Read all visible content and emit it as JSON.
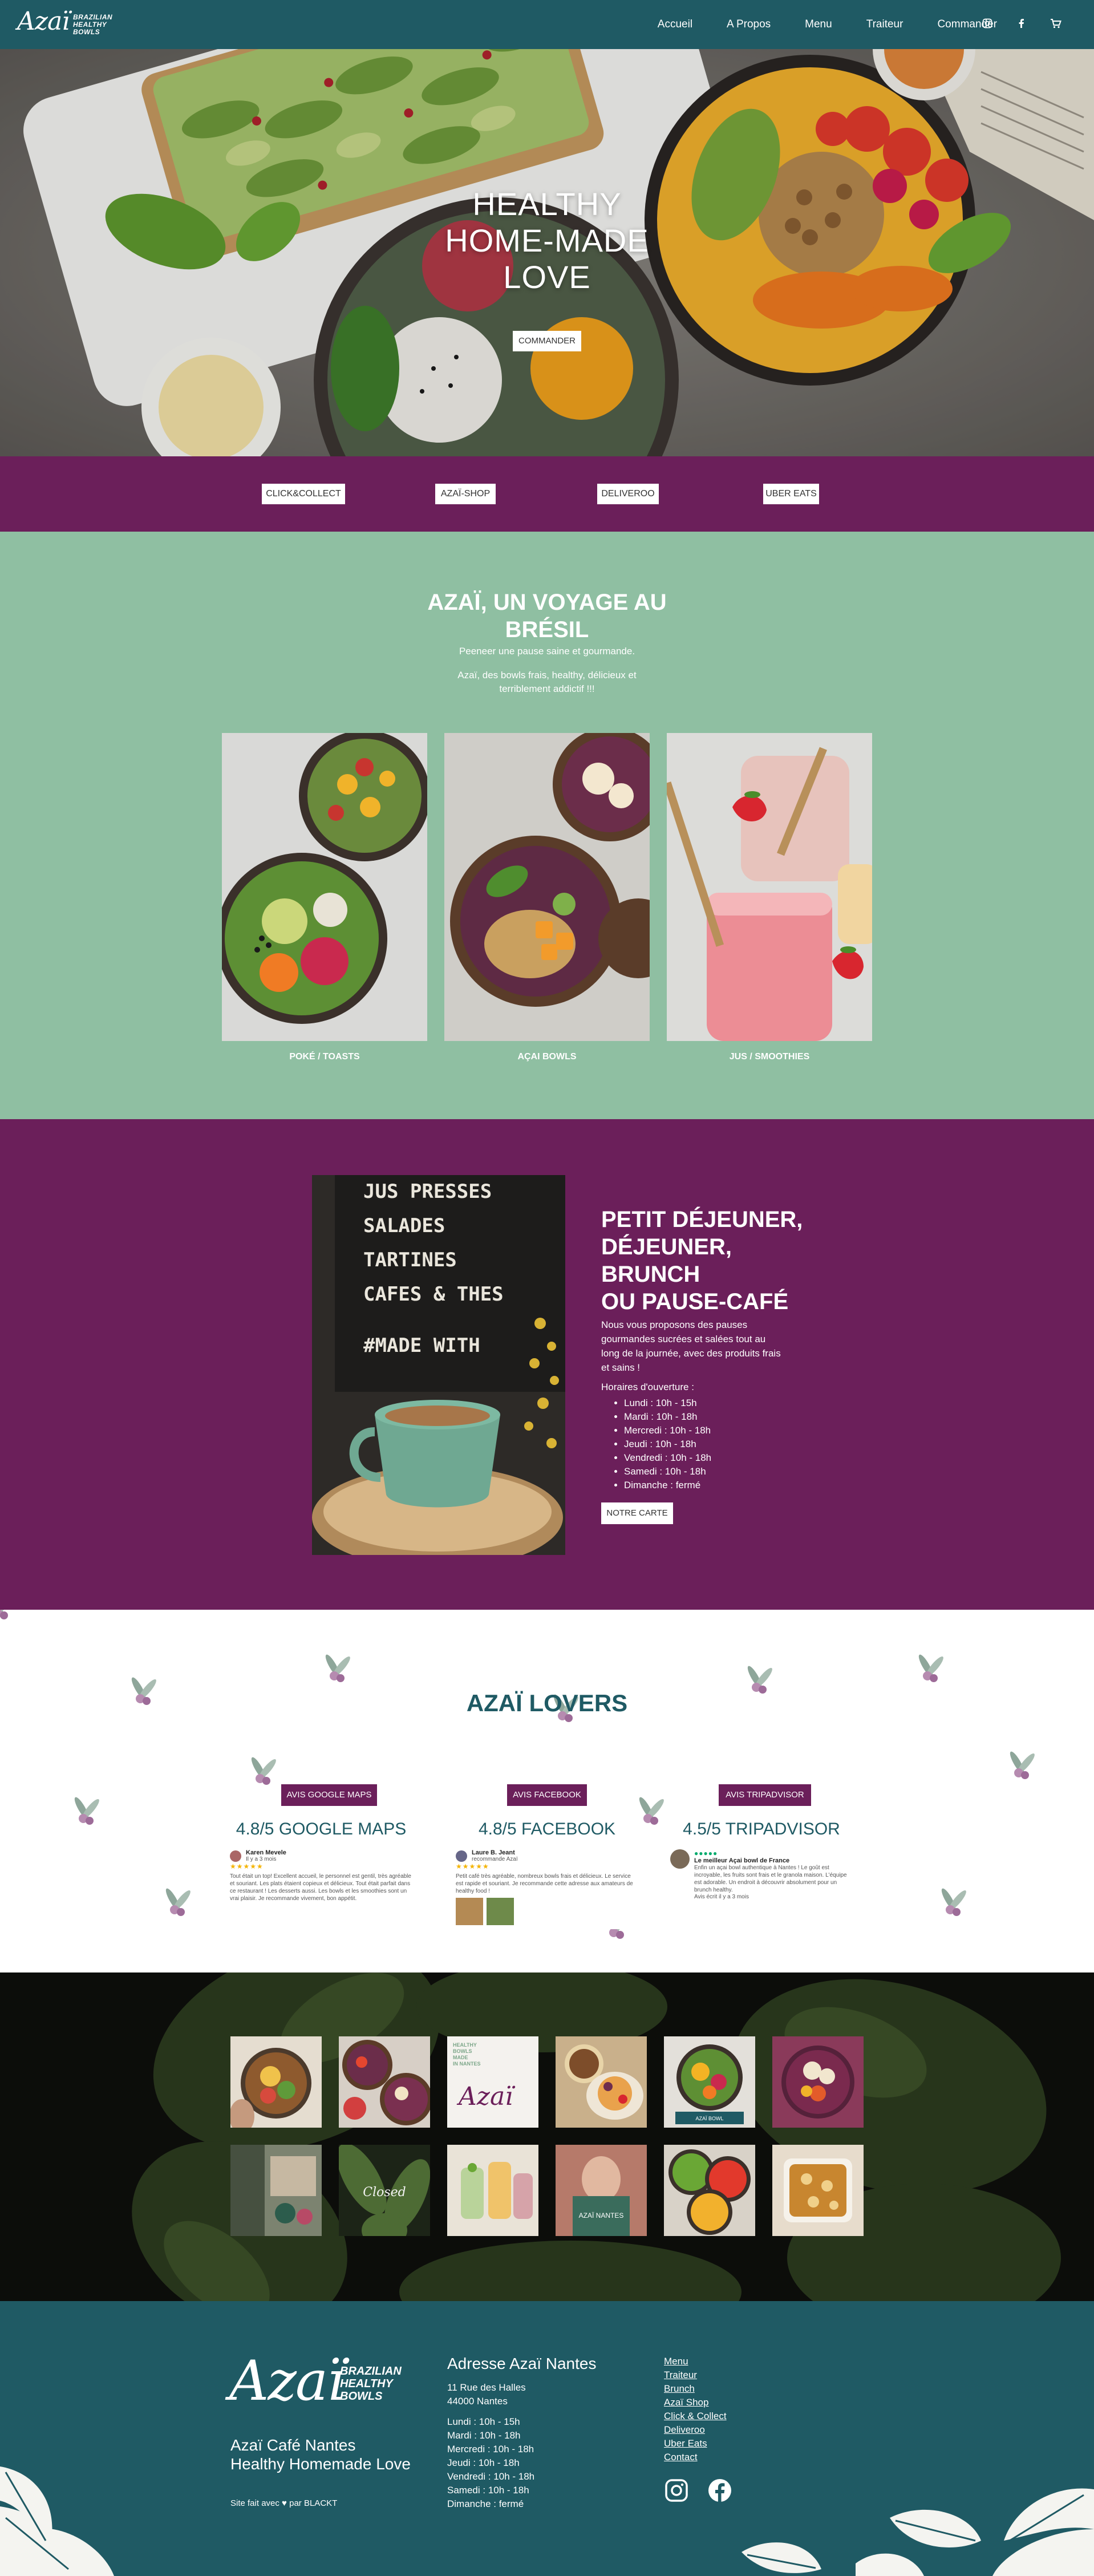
{
  "nav": {
    "logo_script": "Azaï",
    "logo_tag": [
      "BRAZILIAN",
      "HEALTHY",
      "BOWLS"
    ],
    "links": [
      "Accueil",
      "A Propos",
      "Menu",
      "Traiteur",
      "Commander"
    ],
    "icons": [
      "instagram-icon",
      "facebook-icon",
      "cart-icon"
    ]
  },
  "hero": {
    "title_lines": [
      "HEALTHY",
      "HOME-MADE",
      "LOVE"
    ],
    "button": "COMMANDER"
  },
  "order_bar": {
    "buttons": [
      "CLICK&COLLECT",
      "AZAÏ-SHOP",
      "DELIVEROO",
      "UBER EATS"
    ]
  },
  "voyage": {
    "title_lines": [
      "AZAÏ, UN VOYAGE AU",
      "BRÉSIL"
    ],
    "sub1": "Peeneer une pause saine et gourmande.",
    "sub2": "Azaï, des bowls frais, healthy, délicieux et",
    "sub3": "terriblement addictif !!!",
    "cards": [
      "POKÉ / TOASTS",
      "AÇAI BOWLS",
      "JUS / SMOOTHIES"
    ]
  },
  "breakfast": {
    "title_lines": [
      "PETIT DÉJEUNER,",
      "DÉJEUNER,",
      "BRUNCH",
      "OU PAUSE-CAFÉ"
    ],
    "intro": "Nous vous proposons des pauses gourmandes sucrées et salées tout au long de la journée, avec des produits frais et sains !",
    "hours_title": "Horaires d'ouverture :",
    "hours": [
      "Lundi : 10h - 15h",
      "Mardi : 10h - 18h",
      "Mercredi : 10h - 18h",
      "Jeudi : 10h - 18h",
      "Vendredi : 10h - 18h",
      "Samedi : 10h - 18h",
      "Dimanche : fermé"
    ],
    "button": "NOTRE CARTE",
    "board_lines": [
      "JUS PRESSES",
      "SALADES",
      "TARTINES",
      "CAFES & THES",
      "#MADE WITH"
    ]
  },
  "lovers": {
    "title": "AZAÏ LOVERS",
    "reviews": [
      {
        "badge": "AVIS GOOGLE MAPS",
        "score": "4.8/5 GOOGLE MAPS",
        "name": "Karen Mevele",
        "meta": "Il y a 3 mois",
        "text": "Tout était un top! Excellent accueil, le personnel est gentil, très agréable et souriant. Les plats étaient copieux et délicieux. Tout était parfait dans ce restaurant ! Les desserts aussi. Les bowls et les smoothies sont un vrai plaisir. Je recommande vivement, bon appétit."
      },
      {
        "badge": "AVIS FACEBOOK",
        "score": "4.8/5 FACEBOOK",
        "name": "Laure B. Jeant",
        "meta": "recommande Azaï",
        "text": "Petit café très agréable, nombreux bowls frais et délicieux. Le service est rapide et souriant. Je recommande cette adresse aux amateurs de healthy food !"
      },
      {
        "badge": "AVIS TRIPADVISOR",
        "score": "4.5/5 TRIPADVISOR",
        "name": "Le meilleur Açai bowl de France",
        "meta": "Avis écrit il y a 3 mois",
        "text": "Enfin un açai bowl authentique à Nantes ! Le goût est incroyable, les fruits sont frais et le granola maison. L'équipe est adorable. Un endroit à découvrir absolument pour un brunch healthy."
      }
    ]
  },
  "insta": {
    "tiles": [
      "insta-1",
      "insta-2",
      "insta-3",
      "insta-4",
      "insta-5",
      "insta-6",
      "insta-7",
      "insta-8",
      "insta-9",
      "insta-10",
      "insta-11",
      "insta-12"
    ],
    "tile3_text": [
      "HEALTHY",
      "BOWLS",
      "MADE",
      "IN NANTES"
    ],
    "tile3_logo": "Azaï",
    "tile8_text": "Closed",
    "tile10_text": "AZAÏ NANTES",
    "tile11_text": "AZAÏ BOWL"
  },
  "footer": {
    "logo_script": "Azaï",
    "logo_tag": [
      "BRAZILIAN",
      "HEALTHY",
      "BOWLS"
    ],
    "tagline": "Azaï Café Nantes Healthy Homemade Love",
    "credit": "Site fait avec ♥ par BLACKT",
    "addr_title": "Adresse Azaï Nantes",
    "addr": [
      "11 Rue des Halles",
      "44000 Nantes"
    ],
    "hours": [
      "Lundi : 10h - 15h",
      "Mardi : 10h - 18h",
      "Mercredi : 10h - 18h",
      "Jeudi : 10h - 18h",
      "Vendredi : 10h - 18h",
      "Samedi : 10h - 18h",
      "Dimanche : fermé"
    ],
    "menu": [
      "Menu",
      "Traiteur",
      "Brunch",
      "Azaï Shop",
      "Click & Collect",
      "Deliveroo",
      "Uber Eats",
      "Contact"
    ],
    "social": [
      "instagram-icon",
      "facebook-icon"
    ]
  },
  "colors": {
    "teal": "#1f5a64",
    "plum": "#6b1f5a",
    "sage": "#8fbfa2"
  }
}
